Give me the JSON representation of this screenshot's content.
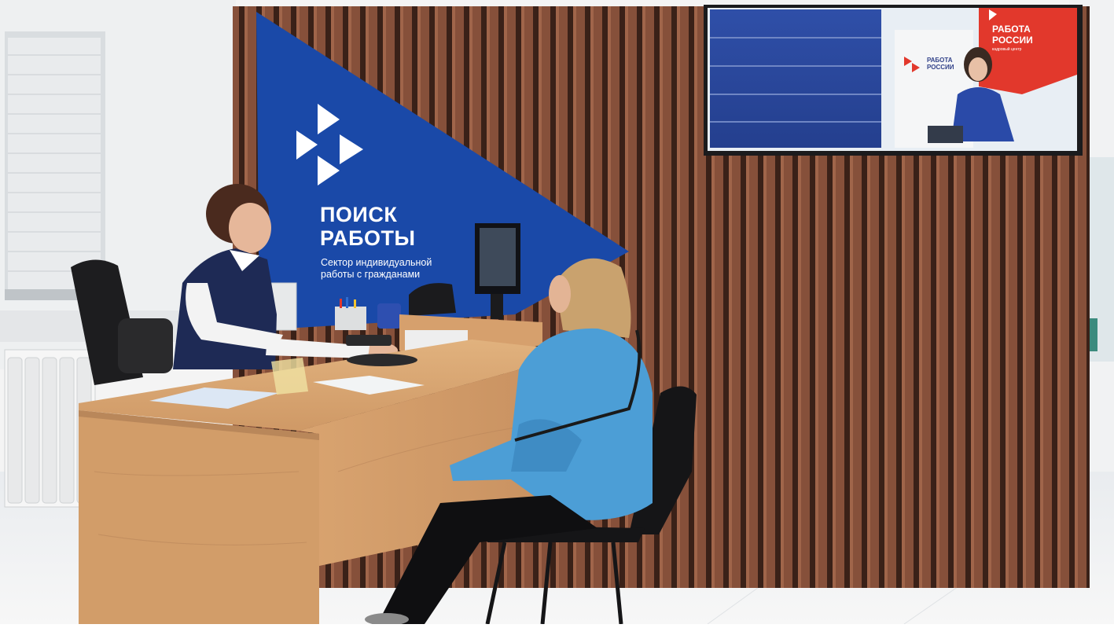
{
  "sign": {
    "title_line1": "ПОИСК",
    "title_line2": "РАБОТЫ",
    "subtitle_line1": "Сектор индивидуальной",
    "subtitle_line2": "работы с гражданами"
  },
  "tv": {
    "banner_line1": "РАБОТА",
    "banner_line2": "РОССИИ",
    "inset_line1": "РАБОТА",
    "inset_line2": "РОССИИ",
    "caption": "кадровый центр"
  },
  "colors": {
    "sign_blue": "#1a49a8",
    "wood_slats": "#7a4a36",
    "desk": "#d8a46f",
    "tv_red": "#e2382c",
    "jacket": "#4c9ed6"
  }
}
